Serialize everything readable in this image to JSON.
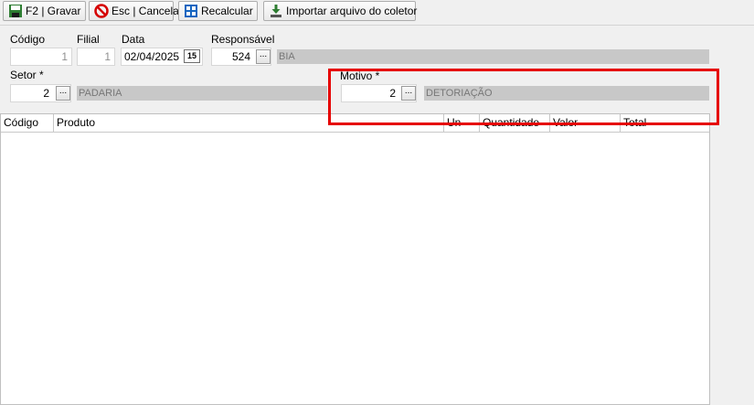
{
  "toolbar": {
    "save_label": "F2 | Gravar",
    "cancel_label": "Esc | Cancelar",
    "recalc_label": "Recalcular",
    "import_label": "Importar arquivo do coletor"
  },
  "form": {
    "codigo_label": "Código",
    "codigo_value": "1",
    "filial_label": "Filial",
    "filial_value": "1",
    "data_label": "Data",
    "data_value": "02/04/2025",
    "calendar_text": "15",
    "responsavel_label": "Responsável",
    "responsavel_code": "524",
    "responsavel_name": "BIA",
    "setor_label": "Setor *",
    "setor_code": "2",
    "setor_name": "PADARIA",
    "motivo_label": "Motivo *",
    "motivo_code": "2",
    "motivo_name": "DETORIAÇÃO",
    "ellipsis": "..."
  },
  "grid": {
    "columns": [
      "Código",
      "Produto",
      "Un",
      "Quantidade",
      "Valor",
      "Total"
    ]
  },
  "colors": {
    "highlight": "#e60000",
    "readonly_fill": "#c8c8c8"
  }
}
